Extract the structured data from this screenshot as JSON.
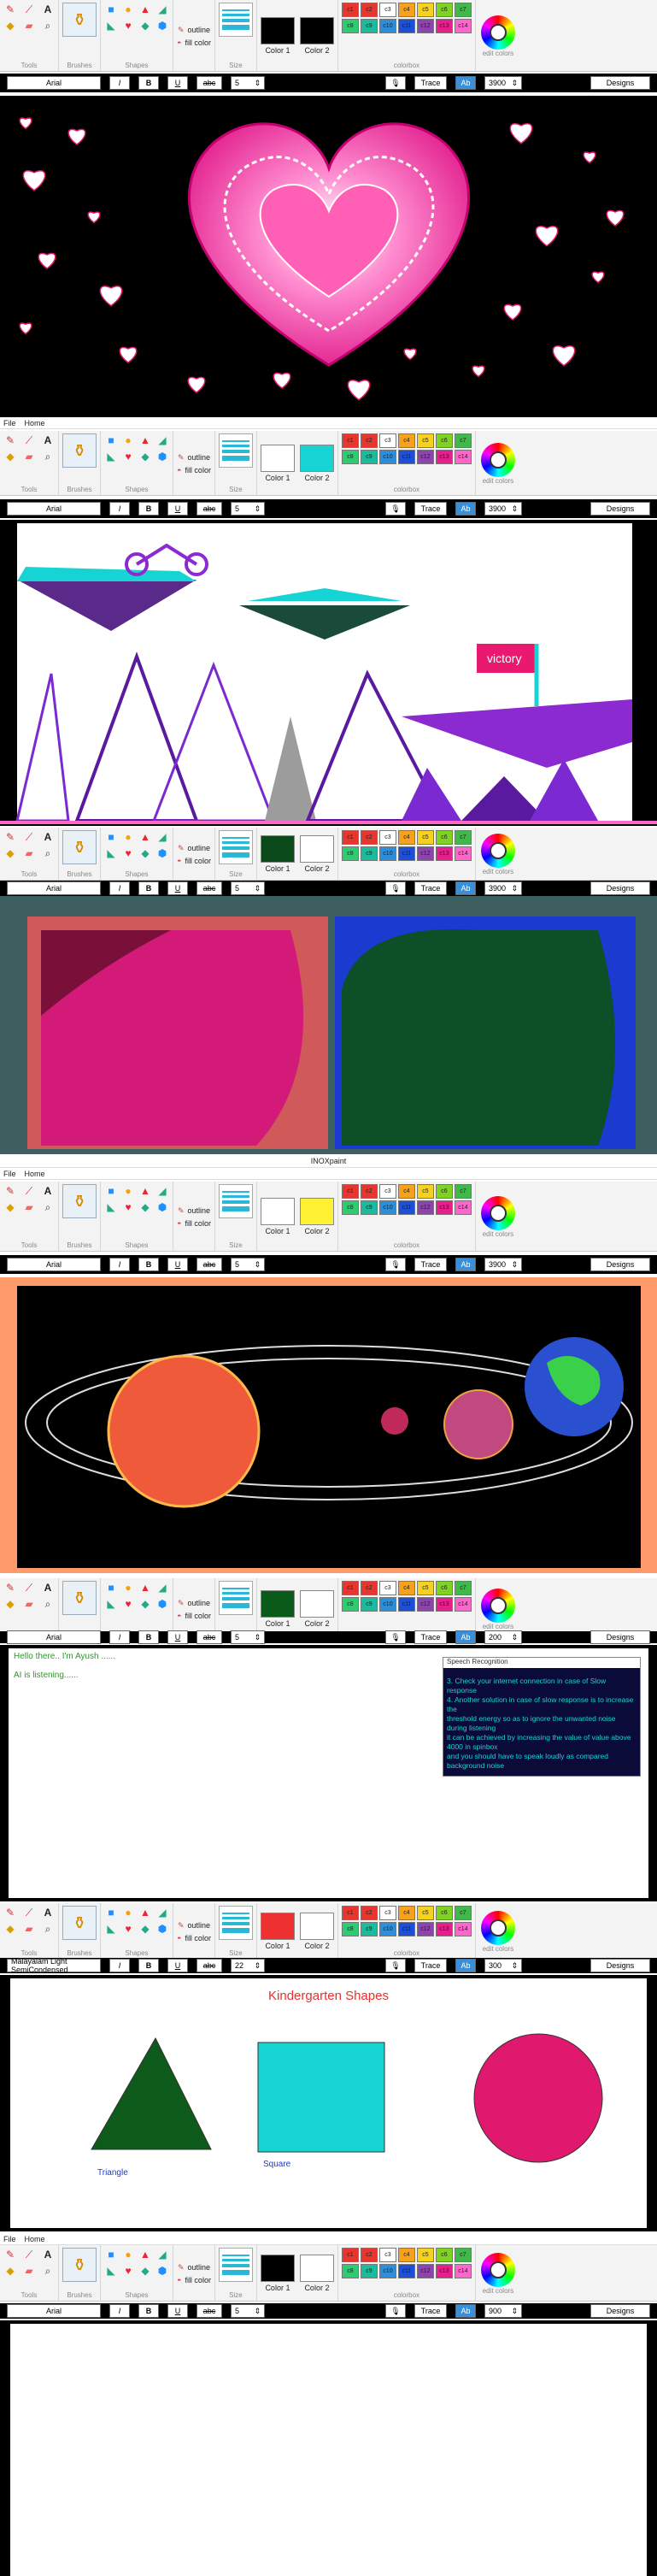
{
  "app_title": "INOXpaint",
  "menu": [
    "File",
    "Home"
  ],
  "ribbon": {
    "groups": {
      "tools": "Tools",
      "brushes": "Brushes",
      "shapes": "Shapes",
      "size": "Size",
      "colorbox": "colorbox",
      "edit_colors": "edit colors"
    },
    "outline_label": "outline",
    "fill_color_label": "fill color",
    "color1_label": "Color 1",
    "color2_label": "Color 2",
    "palette_top": [
      "c1",
      "c2",
      "c3",
      "c4",
      "c5",
      "c6",
      "c7"
    ],
    "palette_bottom": [
      "c8",
      "c9",
      "c10",
      "c11",
      "c12",
      "c13",
      "c14"
    ],
    "palette_top_colors": [
      "#e8352e",
      "#e8352e",
      "#ffffff",
      "#f6a21c",
      "#f6d21c",
      "#7ed321",
      "#41b84a"
    ],
    "palette_bottom_colors": [
      "#2ecc71",
      "#1abc9c",
      "#2d8fdb",
      "#1e4fd8",
      "#8e44ad",
      "#e91e8c",
      "#ff66cc"
    ]
  },
  "fontbar": {
    "font": "Arial",
    "italic": "I",
    "bold": "B",
    "underline": "U",
    "strike": "abc",
    "size": "5",
    "trace": "Trace",
    "ab": "Ab",
    "value": "3900",
    "designs": "Designs"
  },
  "panel5_fontbar": {
    "value": "200"
  },
  "panel6_fontbar": {
    "font": "Malayalam Light SemiCondensed",
    "size": "22",
    "value": "300"
  },
  "panel7_fontbar": {
    "value": "900"
  },
  "landscape": {
    "flag": "victory"
  },
  "speech": {
    "greeting": "Hello there.. I'm Ayush ......",
    "listening": "AI is listening......",
    "panel_title": "Speech Recognition",
    "tips": [
      "3. Check your internet connection in case of Slow response",
      "4. Another solution in case of slow response is to increase the",
      "threshold energy so as to ignore the unwanted noise during listening",
      "it can be achieved by increasing the value of value above 4000 in spinbox",
      " and you should have to speak loudly as compared background noise"
    ]
  },
  "kindergarten": {
    "title": "Kindergarten Shapes",
    "triangle": "Triangle",
    "square": "Square"
  },
  "colors": {
    "panel1_c1": "#000000",
    "panel1_c2": "#000000",
    "panel2_c1": "#ffffff",
    "panel2_c2": "#17d4d4",
    "panel3_c1": "#0a4a1a",
    "panel3_c2": "#ffffff",
    "panel4_c1": "#ffffff",
    "panel4_c2": "#fff233",
    "panel5_c1": "#0a5a1a",
    "panel5_c2": "#ffffff",
    "panel6_c1": "#ee3030",
    "panel6_c2": "#ffffff",
    "panel7_c1": "#000000",
    "panel7_c2": "#ffffff"
  }
}
